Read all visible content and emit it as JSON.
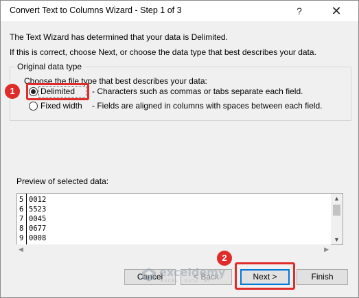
{
  "window": {
    "title": "Convert Text to Columns Wizard - Step 1 of 3",
    "help_glyph": "?",
    "close_glyph": "✕"
  },
  "intro": {
    "line1": "The Text Wizard has determined that your data is Delimited.",
    "line2": "If this is correct, choose Next, or choose the data type that best describes your data."
  },
  "data_type": {
    "group_label": "Original data type",
    "choose_label": "Choose the file type that best describes your data:",
    "options": [
      {
        "label": "Delimited",
        "description": "- Characters such as commas or tabs separate each field.",
        "selected": true
      },
      {
        "label": "Fixed width",
        "description": "- Fields are aligned in columns with spaces between each field.",
        "selected": false
      }
    ]
  },
  "preview": {
    "label": "Preview of selected data:",
    "rows": [
      {
        "num": "5",
        "value": "0012"
      },
      {
        "num": "6",
        "value": "5523"
      },
      {
        "num": "7",
        "value": "0045"
      },
      {
        "num": "8",
        "value": "0677"
      },
      {
        "num": "9",
        "value": "0008"
      }
    ]
  },
  "buttons": {
    "cancel": "Cancel",
    "back": "< Back",
    "next": "Next >",
    "finish": "Finish"
  },
  "watermark": {
    "name": "exceldemy",
    "tagline": "EXCEL · DATA · BI"
  },
  "annotations": {
    "badge1": "1",
    "badge2": "2",
    "highlight_color": "#e02b2b"
  },
  "colors": {
    "focus_border": "#0078d7"
  }
}
